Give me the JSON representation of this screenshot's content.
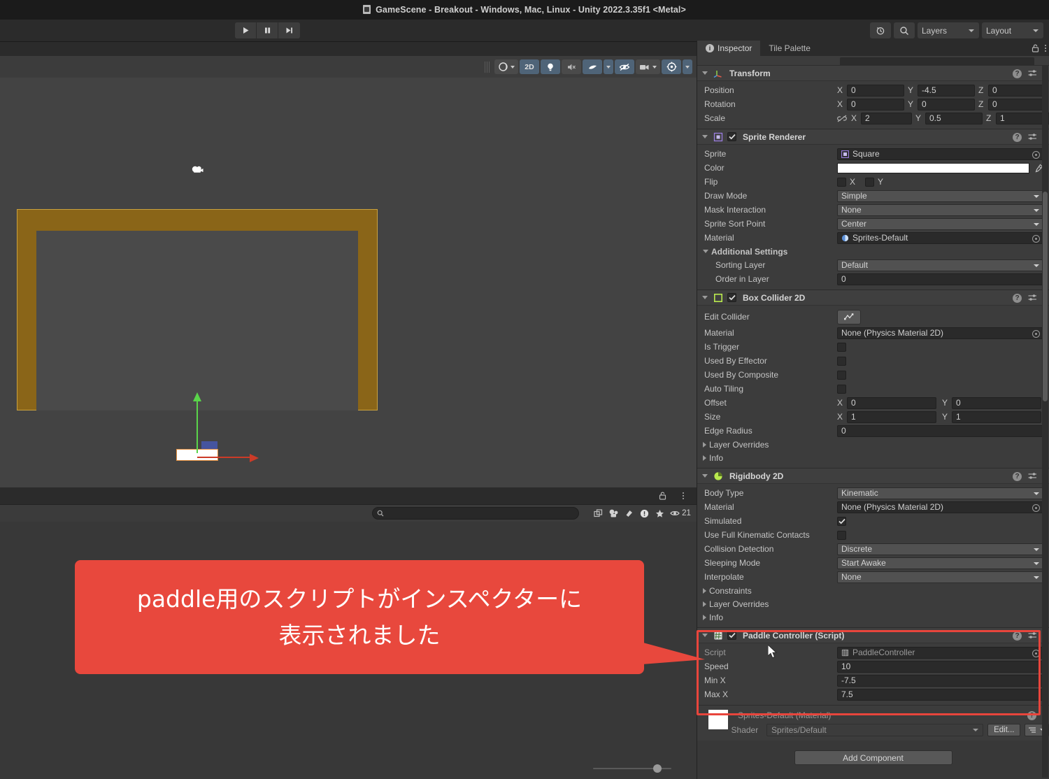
{
  "window": {
    "title": "GameScene - Breakout - Windows, Mac, Linux - Unity 2022.3.35f1 <Metal>",
    "doc_icon": "unity-scene-icon"
  },
  "toolbar": {
    "play_icon": "play-icon",
    "pause_icon": "pause-icon",
    "step_icon": "step-icon",
    "history_icon": "cloud-history-icon",
    "search_icon": "search-icon",
    "layers_label": "Layers",
    "layout_label": "Layout"
  },
  "scene_toolbar": {
    "shading_icon": "shading-mode-icon",
    "mode_2d_label": "2D",
    "lighting_icon": "lightbulb-icon",
    "audio_icon": "audio-mute-icon",
    "effects_icon": "effects-icon",
    "visibility_icon": "eye-off-icon",
    "camera_icon": "camera-icon",
    "gizmos_icon": "gizmos-icon"
  },
  "scene": {
    "camera_gizmo": "camera-gizmo-icon",
    "paddle_object": "paddle-sprite",
    "move_gizmo_y": "green-axis-arrow",
    "move_gizmo_x": "red-axis-arrow"
  },
  "lower_panel": {
    "search_placeholder": "",
    "search_value": "",
    "icons": [
      "expand-icon",
      "prefab-icon",
      "tag-icon",
      "warning-icon",
      "favorite-icon"
    ],
    "visible_count": "21",
    "lock_icon": "lock-icon",
    "menu_icon": "kebab-menu-icon"
  },
  "inspector": {
    "tabs": [
      {
        "label": "Inspector",
        "icon": "info-icon",
        "active": true
      },
      {
        "label": "Tile Palette",
        "icon": "",
        "active": false
      }
    ],
    "lock_icon": "lock-icon",
    "menu_icon": "kebab-menu-icon",
    "components": [
      {
        "name": "Transform",
        "icon": "transform-icon",
        "has_checkbox": false,
        "rows": [
          {
            "label": "Position",
            "type": "vector3",
            "x": "0",
            "y": "-4.5",
            "z": "0"
          },
          {
            "label": "Rotation",
            "type": "vector3",
            "x": "0",
            "y": "0",
            "z": "0"
          },
          {
            "label": "Scale",
            "type": "vector3-linked",
            "x": "2",
            "y": "0.5",
            "z": "1",
            "link_icon": "link-off-icon"
          }
        ]
      },
      {
        "name": "Sprite Renderer",
        "icon": "sprite-renderer-icon",
        "has_checkbox": true,
        "checked": true,
        "rows": [
          {
            "label": "Sprite",
            "type": "object",
            "value": "Square",
            "obj_icon": "sprite-icon"
          },
          {
            "label": "Color",
            "type": "color",
            "value": "#FFFFFF",
            "eyedropper": "eyedropper-icon"
          },
          {
            "label": "Flip",
            "type": "flip",
            "x_label": "X",
            "y_label": "Y",
            "x_checked": false,
            "y_checked": false
          },
          {
            "label": "Draw Mode",
            "type": "dropdown",
            "value": "Simple"
          },
          {
            "label": "Mask Interaction",
            "type": "dropdown",
            "value": "None"
          },
          {
            "label": "Sprite Sort Point",
            "type": "dropdown",
            "value": "Center"
          },
          {
            "label": "Material",
            "type": "object",
            "value": "Sprites-Default",
            "obj_icon": "material-icon"
          },
          {
            "label": "Additional Settings",
            "type": "subheader"
          },
          {
            "label": "Sorting Layer",
            "type": "dropdown",
            "value": "Default",
            "indent": true
          },
          {
            "label": "Order in Layer",
            "type": "text",
            "value": "0",
            "indent": true
          }
        ]
      },
      {
        "name": "Box Collider 2D",
        "icon": "box-collider-2d-icon",
        "has_checkbox": true,
        "checked": true,
        "rows": [
          {
            "label": "Edit Collider",
            "type": "button",
            "button_icon": "edit-collider-icon"
          },
          {
            "label": "Material",
            "type": "object",
            "value": "None (Physics Material 2D)"
          },
          {
            "label": "Is Trigger",
            "type": "checkbox",
            "checked": false
          },
          {
            "label": "Used By Effector",
            "type": "checkbox",
            "checked": false
          },
          {
            "label": "Used By Composite",
            "type": "checkbox",
            "checked": false
          },
          {
            "label": "Auto Tiling",
            "type": "checkbox",
            "checked": false
          },
          {
            "label": "Offset",
            "type": "vector2",
            "x": "0",
            "y": "0"
          },
          {
            "label": "Size",
            "type": "vector2",
            "x": "1",
            "y": "1"
          },
          {
            "label": "Edge Radius",
            "type": "text",
            "value": "0"
          },
          {
            "label": "Layer Overrides",
            "type": "foldout"
          },
          {
            "label": "Info",
            "type": "foldout"
          }
        ]
      },
      {
        "name": "Rigidbody 2D",
        "icon": "rigidbody-2d-icon",
        "has_checkbox": false,
        "rows": [
          {
            "label": "Body Type",
            "type": "dropdown",
            "value": "Kinematic"
          },
          {
            "label": "Material",
            "type": "object",
            "value": "None (Physics Material 2D)"
          },
          {
            "label": "Simulated",
            "type": "checkbox",
            "checked": true
          },
          {
            "label": "Use Full Kinematic Contacts",
            "type": "checkbox",
            "checked": false
          },
          {
            "label": "Collision Detection",
            "type": "dropdown",
            "value": "Discrete"
          },
          {
            "label": "Sleeping Mode",
            "type": "dropdown",
            "value": "Start Awake"
          },
          {
            "label": "Interpolate",
            "type": "dropdown",
            "value": "None"
          },
          {
            "label": "Constraints",
            "type": "foldout"
          },
          {
            "label": "Layer Overrides",
            "type": "foldout"
          },
          {
            "label": "Info",
            "type": "foldout"
          }
        ]
      },
      {
        "name": "Paddle Controller (Script)",
        "icon": "script-icon",
        "has_checkbox": true,
        "checked": true,
        "highlighted": true,
        "rows": [
          {
            "label": "Script",
            "type": "object",
            "value": "PaddleController",
            "obj_icon": "cs-script-icon",
            "disabled": true
          },
          {
            "label": "Speed",
            "type": "text",
            "value": "10"
          },
          {
            "label": "Min X",
            "type": "text",
            "value": "-7.5"
          },
          {
            "label": "Max X",
            "type": "text",
            "value": "7.5"
          }
        ]
      }
    ],
    "material_preview": {
      "title": "Sprites-Default (Material)",
      "shader_label": "Shader",
      "shader_value": "Sprites/Default",
      "edit_label": "Edit...",
      "help_icon": "help-icon",
      "menu_icon": "kebab-menu-icon",
      "list_icon": "list-icon"
    },
    "add_component_label": "Add Component"
  },
  "annotation": {
    "line1": "paddle用のスクリプトがインスペクターに",
    "line2": "表示されました",
    "bg_color": "#e8483d",
    "text_color": "#ffffff",
    "highlight_color": "#e8453c"
  },
  "cursor": {
    "icon": "mouse-pointer-icon"
  }
}
